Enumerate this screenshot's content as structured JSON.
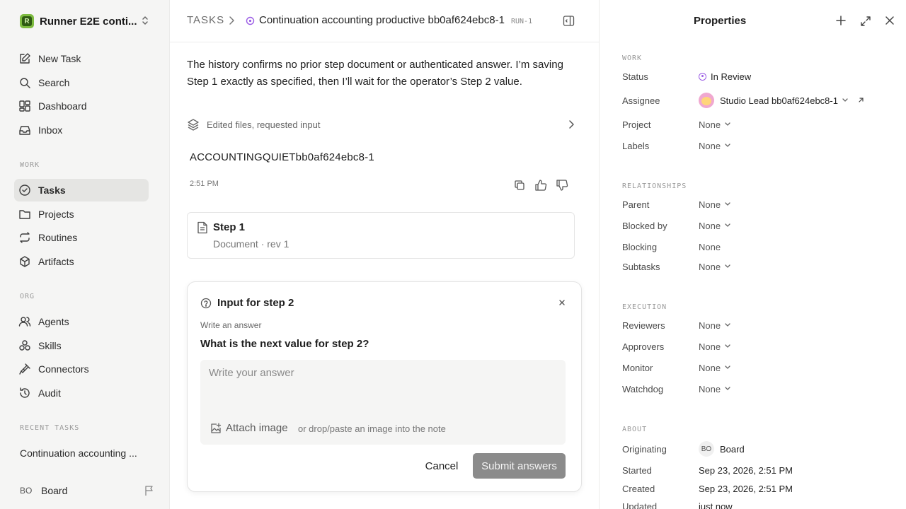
{
  "sidebar": {
    "workspace_name": "Runner E2E conti...",
    "workspace_logo_letter": "R",
    "top_items": [
      {
        "label": "New Task",
        "icon": "edit-icon"
      },
      {
        "label": "Search",
        "icon": "search-icon"
      },
      {
        "label": "Dashboard",
        "icon": "dashboard-icon"
      },
      {
        "label": "Inbox",
        "icon": "inbox-icon"
      }
    ],
    "work_label": "WORK",
    "work_items": [
      {
        "label": "Tasks",
        "icon": "check-circle-icon",
        "active": true
      },
      {
        "label": "Projects",
        "icon": "folder-icon"
      },
      {
        "label": "Routines",
        "icon": "repeat-icon"
      },
      {
        "label": "Artifacts",
        "icon": "box-icon"
      }
    ],
    "org_label": "ORG",
    "org_items": [
      {
        "label": "Agents",
        "icon": "users-icon"
      },
      {
        "label": "Skills",
        "icon": "skills-icon"
      },
      {
        "label": "Connectors",
        "icon": "plug-icon"
      },
      {
        "label": "Audit",
        "icon": "history-icon"
      }
    ],
    "recent_label": "RECENT TASKS",
    "recent_task": "Continuation accounting ...",
    "board_initials": "BO",
    "board_name": "Board"
  },
  "header": {
    "section": "TASKS",
    "title": "Continuation accounting productive bb0af624ebc8-1",
    "run_tag": "RUN-1"
  },
  "conversation": {
    "message": "The history confirms no prior step document or authenticated answer. I’m saving Step 1 exactly as specified, then I’ll wait for the operator’s Step 2 value.",
    "activity_summary": "Edited files, requested input",
    "answer": "ACCOUNTINGQUIETbb0af624ebc8-1",
    "time": "2:51 PM",
    "document": {
      "title": "Step 1",
      "subtitle": "Document · rev 1"
    }
  },
  "input_form": {
    "title": "Input for step 2",
    "hint": "Write an answer",
    "question": "What is the next value for step 2?",
    "placeholder": "Write your answer",
    "attach_label": "Attach image",
    "attach_hint": "or drop/paste an image into the note",
    "cancel_label": "Cancel",
    "submit_label": "Submit answers"
  },
  "properties": {
    "title": "Properties",
    "work_label": "WORK",
    "status_key": "Status",
    "status_value": "In Review",
    "assignee_key": "Assignee",
    "assignee_value": "Studio Lead bb0af624ebc8-1",
    "project_key": "Project",
    "project_value": "None",
    "labels_key": "Labels",
    "labels_value": "None",
    "relationships_label": "RELATIONSHIPS",
    "parent_key": "Parent",
    "parent_value": "None",
    "blocked_by_key": "Blocked by",
    "blocked_by_value": "None",
    "blocking_key": "Blocking",
    "blocking_value": "None",
    "subtasks_key": "Subtasks",
    "subtasks_value": "None",
    "execution_label": "EXECUTION",
    "reviewers_key": "Reviewers",
    "reviewers_value": "None",
    "approvers_key": "Approvers",
    "approvers_value": "None",
    "monitor_key": "Monitor",
    "monitor_value": "None",
    "watchdog_key": "Watchdog",
    "watchdog_value": "None",
    "about_label": "ABOUT",
    "originating_key": "Originating",
    "originating_initials": "BO",
    "originating_value": "Board",
    "started_key": "Started",
    "started_value": "Sep 23, 2026, 2:51 PM",
    "created_key": "Created",
    "created_value": "Sep 23, 2026, 2:51 PM",
    "updated_key": "Updated",
    "updated_value": "just now"
  },
  "colors": {
    "status_in_review": "#9b5de5",
    "submit_disabled": "#8b8b8b",
    "active_nav": "#e5e5e3",
    "workspace_logo": "#7dbb3f"
  }
}
